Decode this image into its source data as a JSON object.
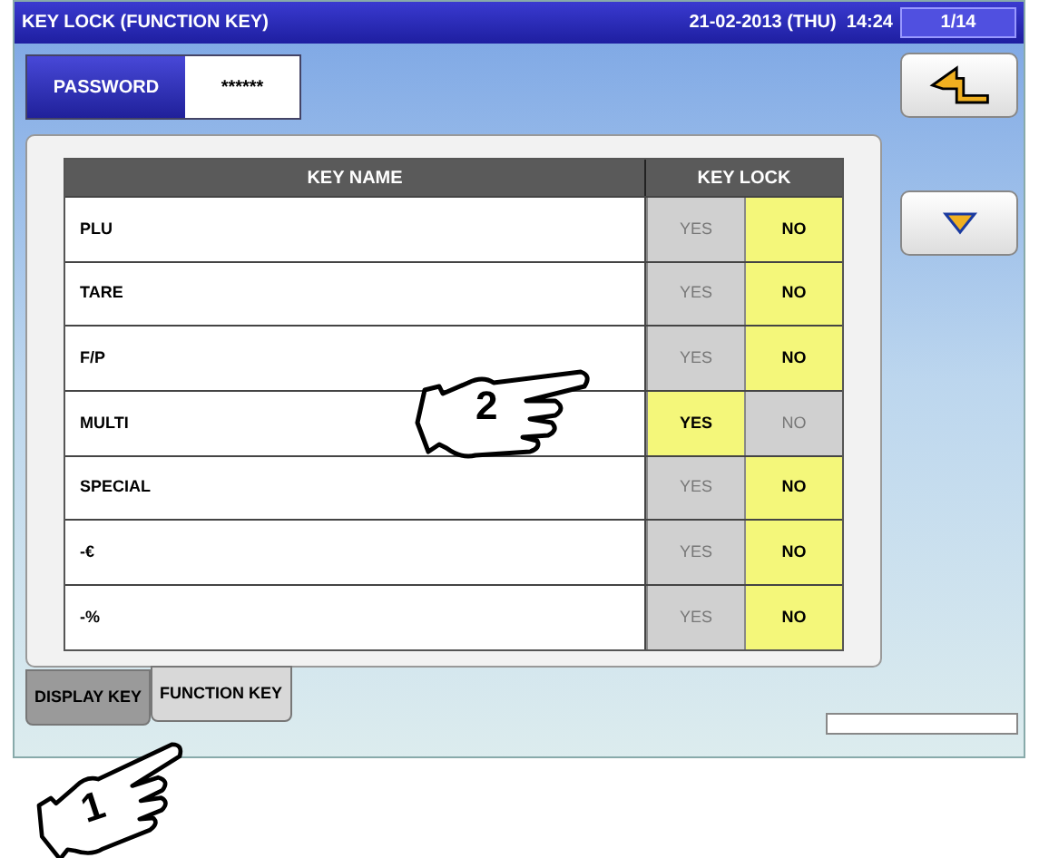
{
  "title_bar": {
    "title": "KEY LOCK (FUNCTION KEY)",
    "datetime": "21-02-2013 (THU)  14:24",
    "page": "1/14"
  },
  "password": {
    "label": "PASSWORD",
    "value": "******"
  },
  "table": {
    "columns": [
      "KEY NAME",
      "KEY LOCK"
    ],
    "rows": [
      {
        "name": "PLU",
        "options": [
          {
            "label": "YES",
            "selected": false
          },
          {
            "label": "NO",
            "selected": true
          }
        ]
      },
      {
        "name": "TARE",
        "options": [
          {
            "label": "YES",
            "selected": false
          },
          {
            "label": "NO",
            "selected": true
          }
        ]
      },
      {
        "name": "F/P",
        "options": [
          {
            "label": "YES",
            "selected": false
          },
          {
            "label": "NO",
            "selected": true
          }
        ]
      },
      {
        "name": "MULTI",
        "options": [
          {
            "label": "YES",
            "selected": true
          },
          {
            "label": "NO",
            "selected": false
          }
        ]
      },
      {
        "name": "SPECIAL",
        "options": [
          {
            "label": "YES",
            "selected": false
          },
          {
            "label": "NO",
            "selected": true
          }
        ]
      },
      {
        "name": "-€",
        "options": [
          {
            "label": "YES",
            "selected": false
          },
          {
            "label": "NO",
            "selected": true
          }
        ]
      },
      {
        "name": "-%",
        "options": [
          {
            "label": "YES",
            "selected": false
          },
          {
            "label": "NO",
            "selected": true
          }
        ]
      }
    ]
  },
  "tabs": [
    {
      "label": "DISPLAY KEY",
      "selected": false
    },
    {
      "label": "FUNCTION KEY",
      "selected": true
    }
  ],
  "annotations": [
    {
      "number": "2"
    },
    {
      "number": "1"
    }
  ]
}
